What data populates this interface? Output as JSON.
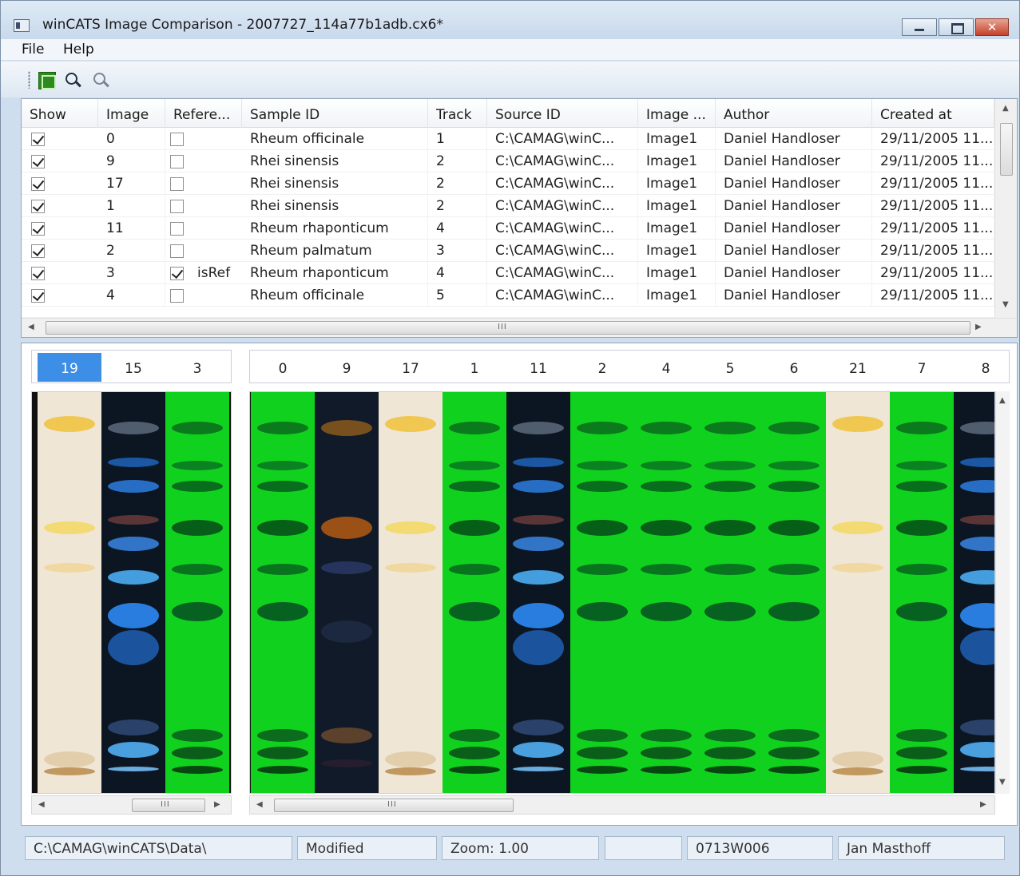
{
  "window": {
    "title": "winCATS Image Comparison - 2007727_114a77b1adb.cx6*",
    "close_glyph": "✕",
    "icons": [
      "app-icon",
      "minimize-icon",
      "maximize-icon",
      "close-icon"
    ]
  },
  "menu": {
    "file": "File",
    "help": "Help"
  },
  "toolbar": {
    "icons": [
      "layout-icon",
      "zoom-in-icon",
      "zoom-out-icon"
    ]
  },
  "grid": {
    "columns": [
      "Show",
      "Image",
      "Refere...",
      "Sample ID",
      "Track",
      "Source ID",
      "Image ...",
      "Author",
      "Created at"
    ],
    "rows": [
      {
        "show": true,
        "image": "0",
        "ref": false,
        "ref_label": "",
        "sample": "Rheum officinale",
        "track": "1",
        "source": "C:\\CAMAG\\winC...",
        "imagename": "Image1",
        "author": "Daniel Handloser",
        "created": "29/11/2005 11..."
      },
      {
        "show": true,
        "image": "9",
        "ref": false,
        "ref_label": "",
        "sample": "Rhei sinensis",
        "track": "2",
        "source": "C:\\CAMAG\\winC...",
        "imagename": "Image1",
        "author": "Daniel Handloser",
        "created": "29/11/2005 11..."
      },
      {
        "show": true,
        "image": "17",
        "ref": false,
        "ref_label": "",
        "sample": "Rhei sinensis",
        "track": "2",
        "source": "C:\\CAMAG\\winC...",
        "imagename": "Image1",
        "author": "Daniel Handloser",
        "created": "29/11/2005 11..."
      },
      {
        "show": true,
        "image": "1",
        "ref": false,
        "ref_label": "",
        "sample": "Rhei sinensis",
        "track": "2",
        "source": "C:\\CAMAG\\winC...",
        "imagename": "Image1",
        "author": "Daniel Handloser",
        "created": "29/11/2005 11..."
      },
      {
        "show": true,
        "image": "11",
        "ref": false,
        "ref_label": "",
        "sample": "Rheum rhaponticum",
        "track": "4",
        "source": "C:\\CAMAG\\winC...",
        "imagename": "Image1",
        "author": "Daniel Handloser",
        "created": "29/11/2005 11..."
      },
      {
        "show": true,
        "image": "2",
        "ref": false,
        "ref_label": "",
        "sample": "Rheum palmatum",
        "track": "3",
        "source": "C:\\CAMAG\\winC...",
        "imagename": "Image1",
        "author": "Daniel Handloser",
        "created": "29/11/2005 11..."
      },
      {
        "show": true,
        "image": "3",
        "ref": true,
        "ref_label": "isRef",
        "sample": "Rheum rhaponticum",
        "track": "4",
        "source": "C:\\CAMAG\\winC...",
        "imagename": "Image1",
        "author": "Daniel Handloser",
        "created": "29/11/2005 11..."
      },
      {
        "show": true,
        "image": "4",
        "ref": false,
        "ref_label": "",
        "sample": "Rheum officinale",
        "track": "5",
        "source": "C:\\CAMAG\\winC...",
        "imagename": "Image1",
        "author": "Daniel Handloser",
        "created": "29/11/2005 11..."
      }
    ],
    "scroll_grip": "III"
  },
  "left_pane": {
    "tracks": [
      {
        "label": "19",
        "selected": true,
        "style": "white"
      },
      {
        "label": "15",
        "selected": false,
        "style": "uv"
      },
      {
        "label": "3",
        "selected": false,
        "style": "green"
      }
    ],
    "scroll_grip": "III"
  },
  "right_pane": {
    "tracks": [
      {
        "label": "0",
        "style": "green"
      },
      {
        "label": "9",
        "style": "uv-dark"
      },
      {
        "label": "17",
        "style": "white"
      },
      {
        "label": "1",
        "style": "green"
      },
      {
        "label": "11",
        "style": "uv"
      },
      {
        "label": "2",
        "style": "green"
      },
      {
        "label": "4",
        "style": "green"
      },
      {
        "label": "5",
        "style": "green"
      },
      {
        "label": "6",
        "style": "green"
      },
      {
        "label": "21",
        "style": "white"
      },
      {
        "label": "7",
        "style": "green"
      },
      {
        "label": "8",
        "style": "uv"
      }
    ],
    "scroll_grip": "III"
  },
  "statusbar": {
    "path": "C:\\CAMAG\\winCATS\\Data\\",
    "state": "Modified",
    "zoom": "Zoom: 1.00",
    "blank": "",
    "id": "0713W006",
    "user": "Jan Masthoff"
  },
  "colors": {
    "selection": "#3d8ee6",
    "green_plate": "#10d21e",
    "white_plate": "#f1e8d9",
    "uv_plate": "#0d1620"
  }
}
